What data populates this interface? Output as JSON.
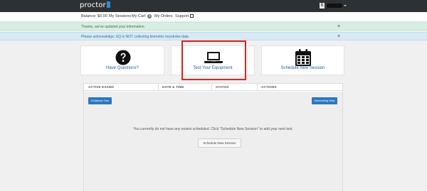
{
  "brand": {
    "name": "proctor"
  },
  "user": {
    "initial": "B"
  },
  "nav": {
    "balance": "Balance: $0.00",
    "my_sessions": "My Sessions",
    "my_cart": "My Cart",
    "cart_count": "0",
    "my_orders": "My Orders",
    "support": "Support"
  },
  "alerts": {
    "success": "Thanks, we've updated your information.",
    "info": "Please acknowledge: UQ is NOT collecting biometric keystroke data",
    "close": "×"
  },
  "cards": [
    {
      "label": "Have Questions?",
      "icon": "question-circle-icon"
    },
    {
      "label": "Test Your Equipment",
      "icon": "laptop-icon"
    },
    {
      "label": "Schedule New Session",
      "icon": "calendar-icon"
    }
  ],
  "table": {
    "headers": [
      "ACTIVE EXAMS",
      "DATE & TIME",
      "STATUS",
      "ACTIONS"
    ],
    "guidance_tour": "Guidance Tour",
    "scheduling_help": "Scheduling Help",
    "empty_message": "You currently do not have any exams scheduled. Click \"Schedule New Session\" to add your next test.",
    "schedule_button": "Schedule New Session"
  },
  "colors": {
    "topbar": "#2d3134",
    "accent": "#2a78c2",
    "link": "#1f5fa8",
    "highlight": "#d9261c",
    "success_bg": "#d9eee2",
    "info_bg": "#d7e9f5"
  }
}
